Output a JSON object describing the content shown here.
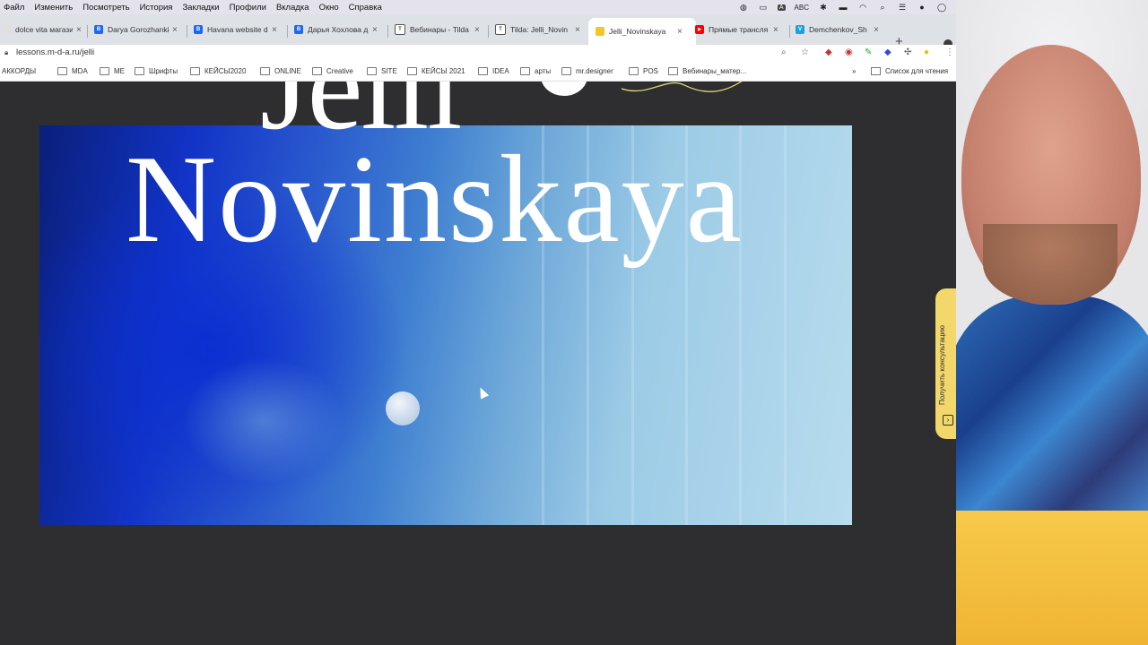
{
  "menubar": {
    "items": [
      "Файл",
      "Изменить",
      "Посмотреть",
      "История",
      "Закладки",
      "Профили",
      "Вкладка",
      "Окно",
      "Справка"
    ],
    "input_source": "ABC"
  },
  "tabs": [
    {
      "title": "dolce vita магазин",
      "favicon_color": "#e0e0e0",
      "favicon_glyph": ""
    },
    {
      "title": "Darya Gorozhankina",
      "favicon_color": "#1769ff",
      "favicon_glyph": "Bē"
    },
    {
      "title": "Havana website de",
      "favicon_color": "#1769ff",
      "favicon_glyph": "Bē"
    },
    {
      "title": "Дарья Хохлова д",
      "favicon_color": "#1769ff",
      "favicon_glyph": "Bē"
    },
    {
      "title": "Вебинары - Tilda",
      "favicon_color": "#555555",
      "favicon_glyph": "T"
    },
    {
      "title": "Tilda: Jelli_Novin",
      "favicon_color": "#555555",
      "favicon_glyph": "T"
    },
    {
      "title": "Jelli_Novinskaya",
      "favicon_color": "#f3c623",
      "favicon_glyph": "J",
      "active": true
    },
    {
      "title": "Прямые трансля",
      "favicon_color": "#ff0000",
      "favicon_glyph": "▶"
    },
    {
      "title": "Demchenkov_Sh",
      "favicon_color": "#1aa0e8",
      "favicon_glyph": "V"
    }
  ],
  "address": {
    "url": "lessons.m-d-a.ru/jelli"
  },
  "bookmarks": [
    {
      "label": "АККОРДЫ"
    },
    {
      "label": "MDA"
    },
    {
      "label": "ME"
    },
    {
      "label": "Шрифты"
    },
    {
      "label": "КЕЙСЫ2020"
    },
    {
      "label": "ONLINE"
    },
    {
      "label": "Creative"
    },
    {
      "label": "SITE"
    },
    {
      "label": "КЕЙСЫ 2021"
    },
    {
      "label": "IDEA"
    },
    {
      "label": "арты"
    },
    {
      "label": "mr.designer"
    },
    {
      "label": "POS"
    },
    {
      "label": "Вебинары_матер..."
    }
  ],
  "bookmarks_more": "»",
  "reading_list": "Список для чтения",
  "page": {
    "title_line1": "Jelli",
    "title_line2": "Novinskaya",
    "consult_label": "Получить консультацию"
  },
  "colors": {
    "page_bg": "#2e2e30",
    "accent_yellow": "#f2d76b",
    "hero_blue": "#1234c8"
  }
}
